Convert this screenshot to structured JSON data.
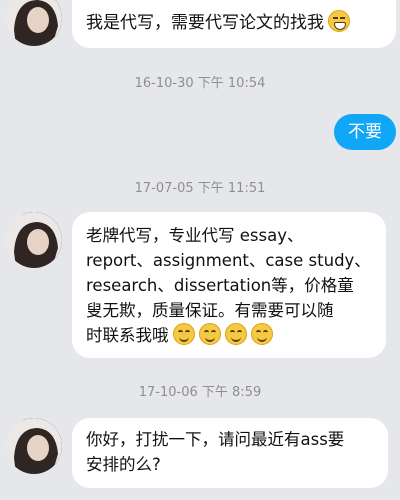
{
  "messages": [
    {
      "side": "received",
      "text": "我是代写，需要代写论文的找我",
      "emoji": [
        "grinning-face-icon"
      ]
    },
    {
      "timestamp": "16-10-30 下午 10:54"
    },
    {
      "side": "sent",
      "text": "不要"
    },
    {
      "timestamp": "17-07-05 下午 11:51"
    },
    {
      "side": "received",
      "lines": [
        "老牌代写，专业代写 essay、",
        "report、assignment、case study、",
        "research、dissertation等，价格童",
        "叟无欺，质量保证。有需要可以随",
        "时联系我哦"
      ],
      "emoji": [
        "smiling-face-icon",
        "smiling-face-icon",
        "smiling-face-icon",
        "smiling-face-icon"
      ]
    },
    {
      "timestamp": "17-10-06 下午 8:59"
    },
    {
      "side": "received",
      "lines": [
        "你好，打扰一下，请问最近有ass要",
        "安排的么?"
      ]
    }
  ],
  "colors": {
    "background": "#e6e7eb",
    "sent_bubble": "#12a7f6",
    "received_bubble": "#ffffff",
    "timestamp": "#8e8e93"
  }
}
